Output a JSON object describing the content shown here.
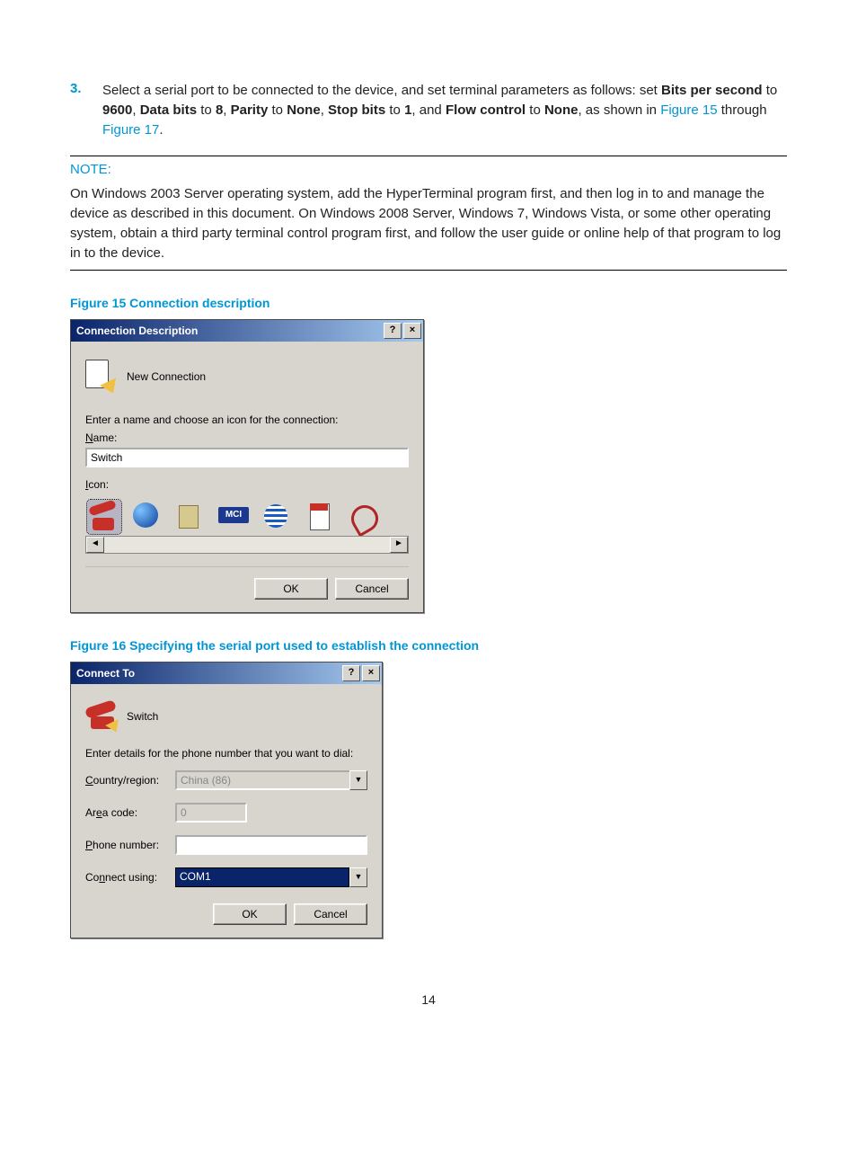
{
  "step": {
    "number": "3.",
    "text_parts": {
      "p1": "Select a serial port to be connected to the device, and set terminal parameters as follows: set ",
      "b1": "Bits per second",
      "p2": " to ",
      "b2": "9600",
      "p3": ", ",
      "b3": "Data bits",
      "p4": " to ",
      "b4": "8",
      "p5": ", ",
      "b5": "Parity",
      "p6": " to ",
      "b6": "None",
      "p7": ", ",
      "b7": "Stop bits",
      "p8": " to ",
      "b8": "1",
      "p9": ", and ",
      "b9": "Flow control",
      "p10": " to ",
      "b10": "None",
      "p11": ", as shown in ",
      "link1": "Figure 15",
      "p12": " through ",
      "link2": "Figure 17",
      "p13": "."
    }
  },
  "note": {
    "label": "NOTE:",
    "body": "On Windows 2003 Server operating system, add the HyperTerminal program first, and then log in to and manage the device as described in this document. On Windows 2008 Server, Windows 7, Windows Vista, or some other operating system, obtain a third party terminal control program first, and follow the user guide or online help of that program to log in to the device."
  },
  "figure15": {
    "caption": "Figure 15 Connection description",
    "title": "Connection Description",
    "help_btn": "?",
    "close_btn": "×",
    "new_conn_label": "New Connection",
    "prompt": "Enter a name and choose an icon for the connection:",
    "name_label_u": "N",
    "name_label_rest": "ame:",
    "name_value": "Switch",
    "icon_label_u": "I",
    "icon_label_rest": "con:",
    "scroll_left": "◄",
    "scroll_right": "►",
    "ok": "OK",
    "cancel": "Cancel"
  },
  "figure16": {
    "caption": "Figure 16 Specifying the serial port used to establish the connection",
    "title": "Connect To",
    "help_btn": "?",
    "close_btn": "×",
    "switch_label": "Switch",
    "prompt": "Enter details for the phone number that you want to dial:",
    "country_label_u": "C",
    "country_label_rest": "ountry/region:",
    "country_value": "China (86)",
    "area_label_pre": "Ar",
    "area_label_u": "e",
    "area_label_rest": "a code:",
    "area_value": "0",
    "phone_label_u": "P",
    "phone_label_rest": "hone number:",
    "phone_value": "",
    "connect_label_pre": "Co",
    "connect_label_u": "n",
    "connect_label_rest": "nect using:",
    "connect_value": "COM1",
    "combo_arrow": "▼",
    "ok": "OK",
    "cancel": "Cancel"
  },
  "page_number": "14"
}
